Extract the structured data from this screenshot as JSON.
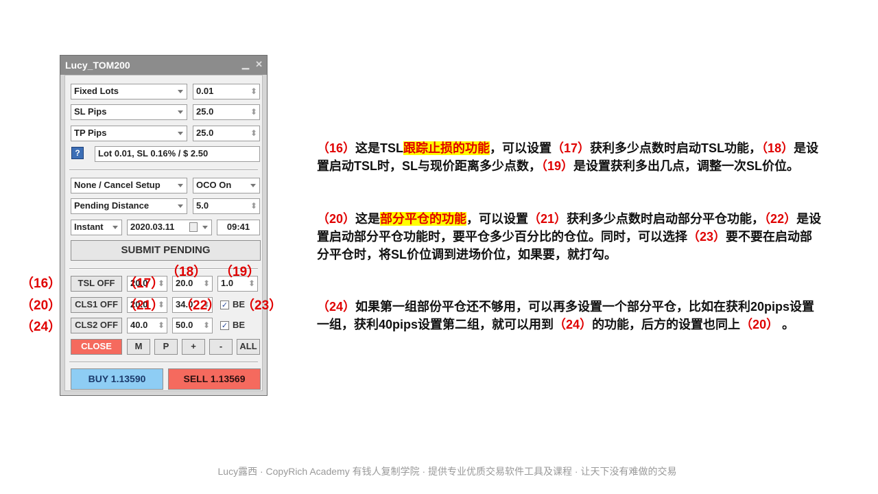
{
  "panel": {
    "title": "Lucy_TOM200",
    "minimize_glyph": "▁",
    "close_glyph": "✕",
    "lot_type": "Fixed Lots",
    "lot_value": "0.01",
    "sl_type": "SL Pips",
    "sl_value": "25.0",
    "tp_type": "TP Pips",
    "tp_value": "25.0",
    "help_glyph": "?",
    "info": "Lot 0.01, SL 0.16% / $ 2.50",
    "pending_setup": "None / Cancel Setup",
    "oco": "OCO On",
    "pending_distance": "Pending Distance",
    "pending_distance_value": "5.0",
    "order_time": "Instant",
    "date": "2020.03.11",
    "time": "09:41",
    "submit": "SUBMIT PENDING",
    "tsl_button": "TSL OFF",
    "tsl_start": "20.0",
    "tsl_distance": "20.0",
    "tsl_step": "1.0",
    "cls1_button": "CLS1 OFF",
    "cls1_start": "20.0",
    "cls1_percent": "34.0",
    "cls1_be_label": "BE",
    "cls2_button": "CLS2 OFF",
    "cls2_start": "40.0",
    "cls2_percent": "50.0",
    "cls2_be_label": "BE",
    "close_button": "CLOSE",
    "m_button": "M",
    "p_button": "P",
    "plus_button": "+",
    "minus_button": "-",
    "all_button": "ALL",
    "buy_button": "BUY 1.13590",
    "sell_button": "SELL 1.13569",
    "close_color": "#f56a5e",
    "buy_color": "#8ecdf4",
    "sell_color": "#f56a5e"
  },
  "annotations": {
    "n16": "（16）",
    "n17": "（17）",
    "n18": "（18）",
    "n19": "（19）",
    "n20": "（20）",
    "n21": "（21）",
    "n22": "（22）",
    "n23": "（23）",
    "n24": "（24）"
  },
  "text": {
    "p1": {
      "a": "（16）",
      "b": "这是TSL",
      "c": "跟踪止损的功能",
      "d": "，可以设置",
      "e": "（17）",
      "f": "获利多少点数时启动TSL功能，",
      "g": "（18）",
      "h": "是设置启动TSL时，SL与现价距离多少点数，",
      "i": "（19）",
      "j": "是设置获利多出几点，调整一次SL价位。"
    },
    "p2": {
      "a": "（20）",
      "b": "这是",
      "c": "部分平仓的功能",
      "d": "，可以设置",
      "e": "（21）",
      "f": "获利多少点数时启动部分平仓功能，",
      "g": "（22）",
      "h": "是设置启动部分平仓功能时，要平仓多少百分比的仓位。同时，可以选择",
      "i": "（23）",
      "j": "要不要在启动部分平仓时，将SL价位调到进场价位，如果要，就打勾。"
    },
    "p3": {
      "a": "（24）",
      "b": "如果第一组部份平仓还不够用，可以再多设置一个部分平仓，比如在获利20pips设置一组，获利40pips设置第二组，就可以用到",
      "c": "（24）",
      "d": "的功能，后方的设置也同上",
      "e": "（20）",
      "f": " 。"
    }
  },
  "footer": "Lucy露西 · CopyRich Academy 有钱人复制学院 · 提供专业优质交易软件工具及课程 · 让天下没有难做的交易"
}
